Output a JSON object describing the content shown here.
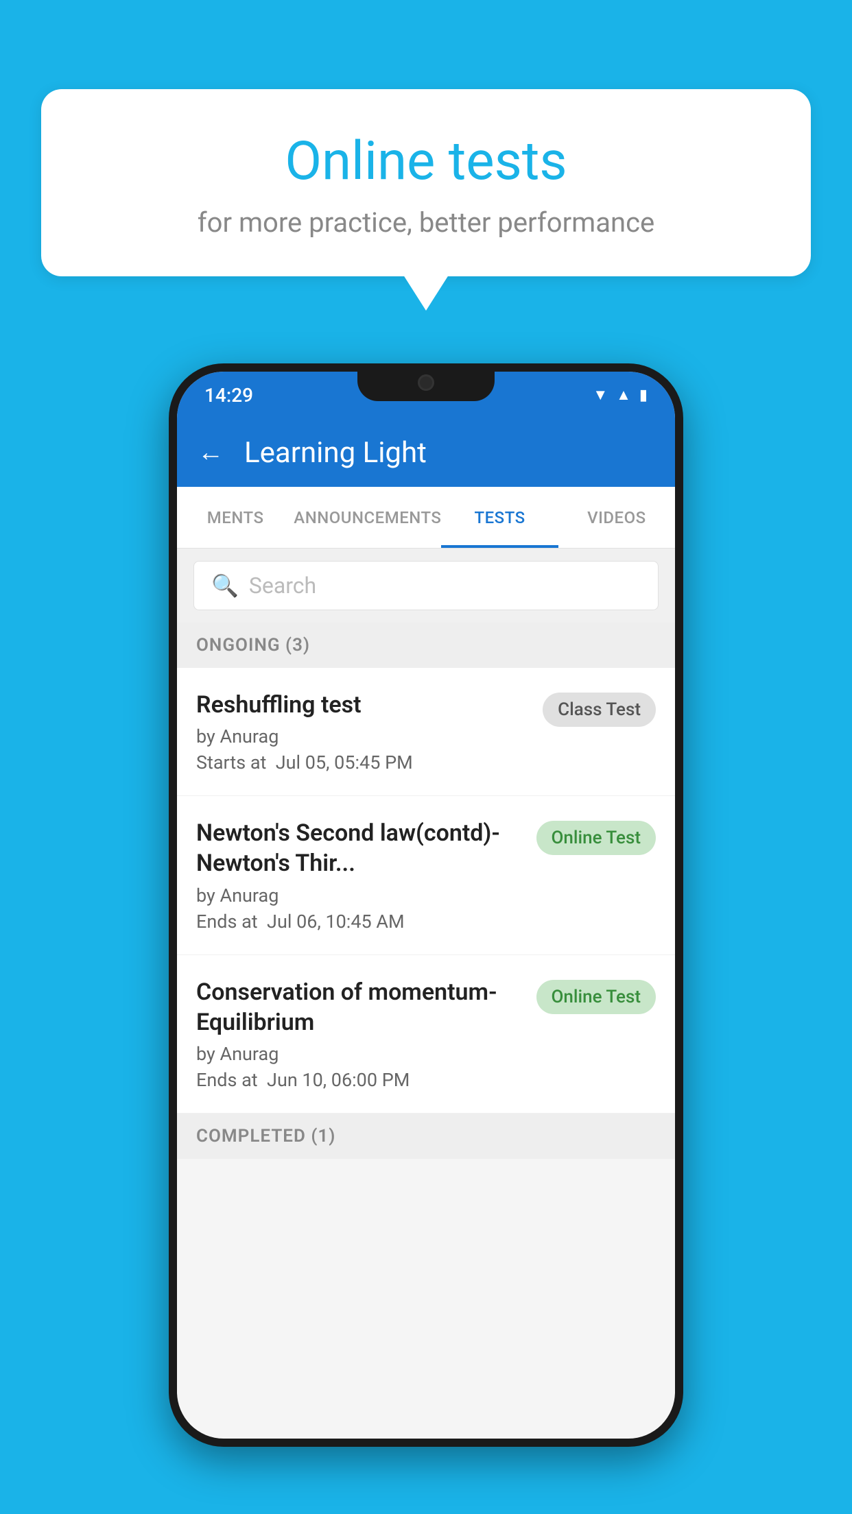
{
  "background_color": "#1ab3e8",
  "speech_bubble": {
    "title": "Online tests",
    "subtitle": "for more practice, better performance"
  },
  "phone": {
    "status_bar": {
      "time": "14:29",
      "icons": [
        "wifi",
        "signal",
        "battery"
      ]
    },
    "app_bar": {
      "title": "Learning Light",
      "back_label": "←"
    },
    "tabs": [
      {
        "label": "MENTS",
        "active": false
      },
      {
        "label": "ANNOUNCEMENTS",
        "active": false
      },
      {
        "label": "TESTS",
        "active": true
      },
      {
        "label": "VIDEOS",
        "active": false
      }
    ],
    "search": {
      "placeholder": "Search"
    },
    "ongoing_section": {
      "label": "ONGOING (3)"
    },
    "tests": [
      {
        "title": "Reshuffling test",
        "author": "by Anurag",
        "date_label": "Starts at",
        "date": "Jul 05, 05:45 PM",
        "badge": "Class Test",
        "badge_type": "class"
      },
      {
        "title": "Newton's Second law(contd)-Newton's Thir...",
        "author": "by Anurag",
        "date_label": "Ends at",
        "date": "Jul 06, 10:45 AM",
        "badge": "Online Test",
        "badge_type": "online"
      },
      {
        "title": "Conservation of momentum-Equilibrium",
        "author": "by Anurag",
        "date_label": "Ends at",
        "date": "Jun 10, 06:00 PM",
        "badge": "Online Test",
        "badge_type": "online"
      }
    ],
    "completed_section": {
      "label": "COMPLETED (1)"
    }
  }
}
